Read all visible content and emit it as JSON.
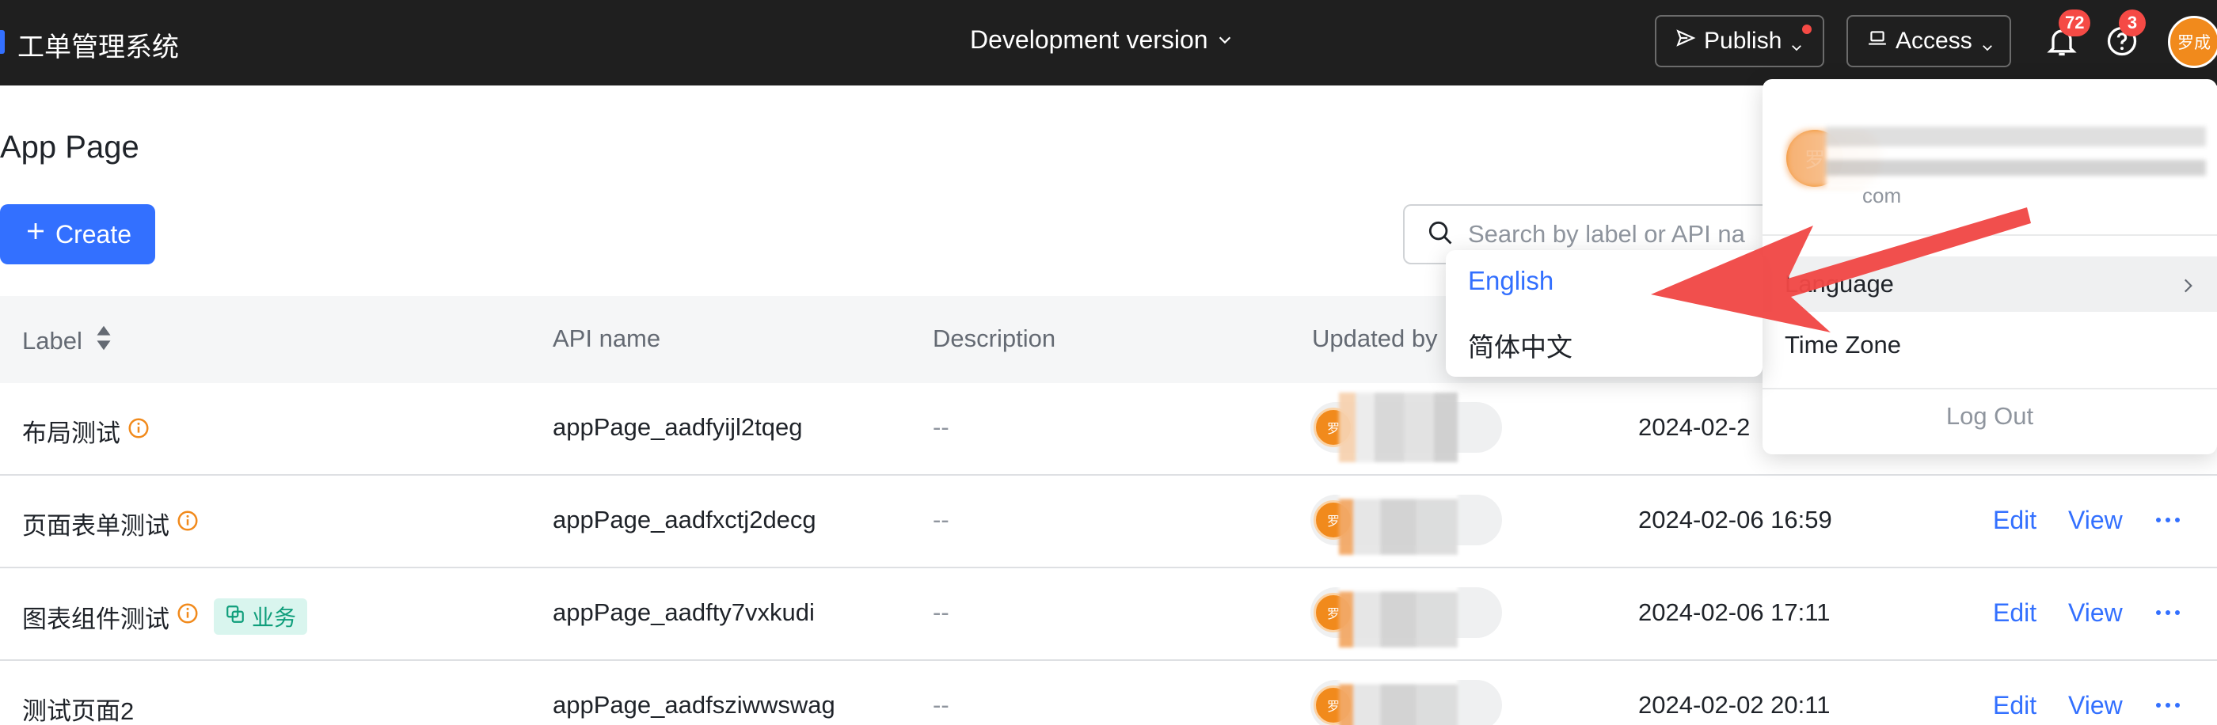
{
  "topbar": {
    "app_name": "工单管理系统",
    "version_label": "Development version",
    "publish_label": "Publish",
    "access_label": "Access",
    "notification_count": "72",
    "help_count": "3",
    "avatar_text": "罗成"
  },
  "page": {
    "title": "App Page",
    "create_label": "Create",
    "search_placeholder": "Search by label or API na"
  },
  "table": {
    "columns": [
      "Label",
      "API name",
      "Description",
      "Updated by"
    ],
    "rows": [
      {
        "label": "布局测试",
        "tag": "",
        "api_name": "appPage_aadfyijl2tqeg",
        "description": "--",
        "avatar": "罗",
        "updated_at": "2024-02-2",
        "edit": "",
        "view": ""
      },
      {
        "label": "页面表单测试",
        "tag": "",
        "api_name": "appPage_aadfxctj2decg",
        "description": "--",
        "avatar": "罗",
        "updated_at": "2024-02-06 16:59",
        "edit": "Edit",
        "view": "View"
      },
      {
        "label": "图表组件测试",
        "tag": "业务",
        "api_name": "appPage_aadfty7vxkudi",
        "description": "--",
        "avatar": "罗",
        "updated_at": "2024-02-06 17:11",
        "edit": "Edit",
        "view": "View"
      },
      {
        "label": "测试页面2",
        "tag": "",
        "api_name": "appPage_aadfsziwwswag",
        "description": "--",
        "avatar": "罗",
        "updated_at": "2024-02-02 20:11",
        "edit": "Edit",
        "view": "View"
      }
    ]
  },
  "user_menu": {
    "avatar_text": "罗",
    "email_tail": "com",
    "language_label": "Language",
    "timezone_label": "Time Zone",
    "logout_label": "Log Out"
  },
  "language_menu": {
    "options": [
      "English",
      "简体中文"
    ],
    "selected": "English"
  },
  "colors": {
    "accent": "#3370ff",
    "topbar_bg": "#1f1f1f",
    "badge_red": "#f54a45",
    "avatar_orange": "#f18a1c",
    "annotation_arrow": "#f04846"
  }
}
